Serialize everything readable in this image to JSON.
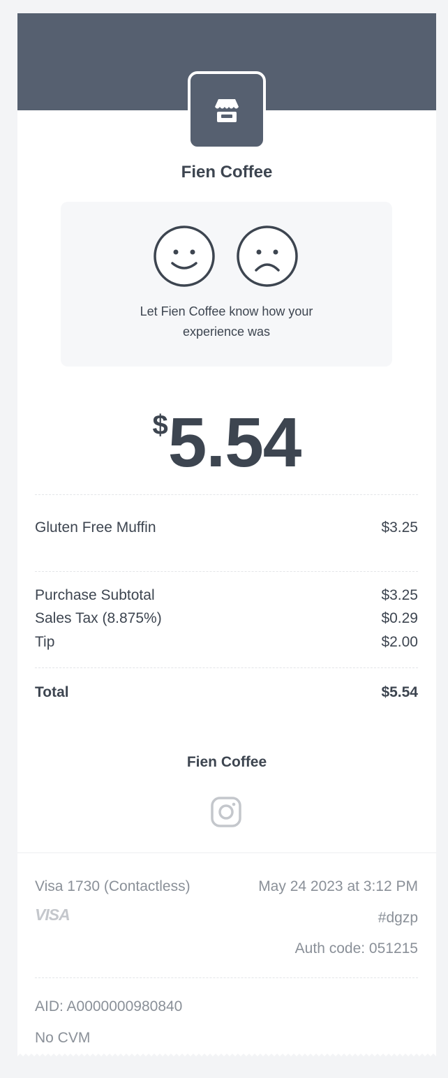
{
  "merchant": {
    "name": "Fien Coffee",
    "logo_icon": "storefront-icon"
  },
  "feedback": {
    "line1": "Let Fien Coffee know how your",
    "line2": "experience was",
    "positive_icon": "happy-face-icon",
    "negative_icon": "sad-face-icon"
  },
  "total_display": {
    "currency": "$",
    "amount": "5.54"
  },
  "line_items": [
    {
      "name": "Gluten Free Muffin",
      "price": "$3.25"
    }
  ],
  "summary": {
    "subtotal_label": "Purchase Subtotal",
    "subtotal_value": "$3.25",
    "tax_label": "Sales Tax (8.875%)",
    "tax_value": "$0.29",
    "tip_label": "Tip",
    "tip_value": "$2.00",
    "total_label": "Total",
    "total_value": "$5.54"
  },
  "footer": {
    "merchant_name": "Fien Coffee",
    "social_icon": "instagram-icon"
  },
  "payment": {
    "card": "Visa 1730 (Contactless)",
    "brand_logo": "VISA",
    "datetime": "May 24 2023 at 3:12 PM",
    "receipt_code": "#dgzp",
    "auth_code": "Auth code: 051215",
    "aid": "AID: A0000000980840",
    "cvm": "No CVM"
  },
  "colors": {
    "header": "#566070",
    "text": "#3d4550",
    "muted": "#8a9098",
    "page_background": "#f3f4f6"
  }
}
